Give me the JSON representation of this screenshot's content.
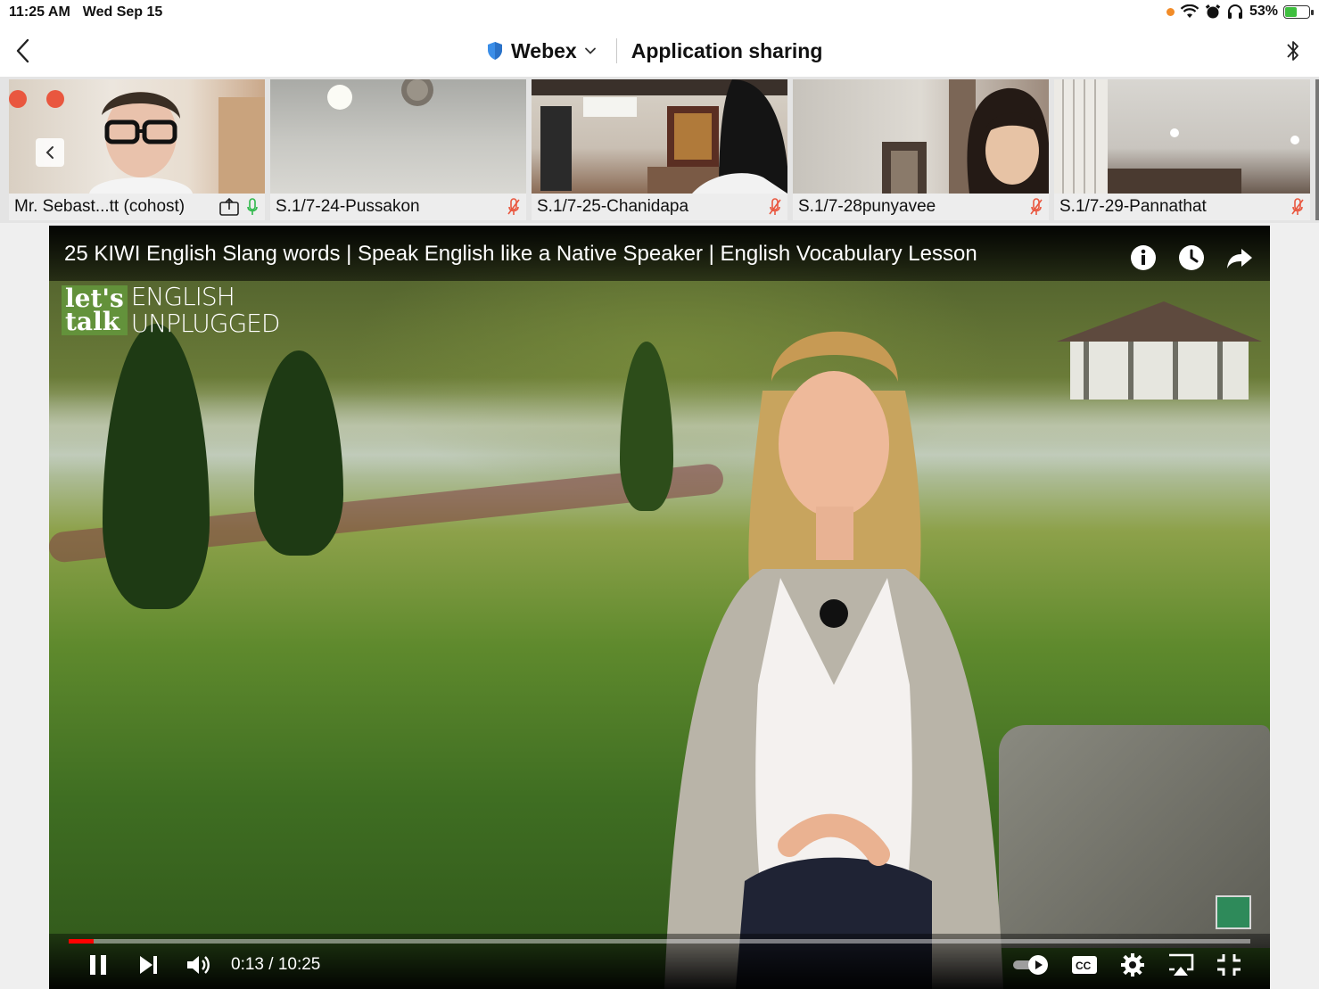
{
  "status_bar": {
    "time": "11:25 AM",
    "date": "Wed Sep 15",
    "battery": "53%",
    "battery_level": 0.53
  },
  "nav": {
    "app_name": "Webex",
    "screen_title": "Application sharing"
  },
  "participants": [
    {
      "name": "Mr. Sebast...tt (cohost)",
      "mic": "on",
      "sharing": true
    },
    {
      "name": "S.1/7-24-Pussakon",
      "mic": "muted"
    },
    {
      "name": "S.1/7-25-Chanidapa",
      "mic": "muted"
    },
    {
      "name": "S.1/7-28punyavee",
      "mic": "muted"
    },
    {
      "name": "S.1/7-29-Pannathat",
      "mic": "muted"
    }
  ],
  "video": {
    "title": "25 KIWI English Slang words | Speak English like a Native Speaker | English Vocabulary Lesson",
    "logo_lets": "let's",
    "logo_talk": "talk",
    "logo_line1": "ENGLISH",
    "logo_line2": "UNPLUGGED",
    "time_display": "0:13 / 10:25",
    "progress": 0.021
  },
  "colors": {
    "accent_red": "#e9573f",
    "mic_on": "#2fb84a",
    "mic_muted": "#e9573f",
    "shield_blue": "#3b8ee8",
    "progress_red": "#ff0000"
  }
}
